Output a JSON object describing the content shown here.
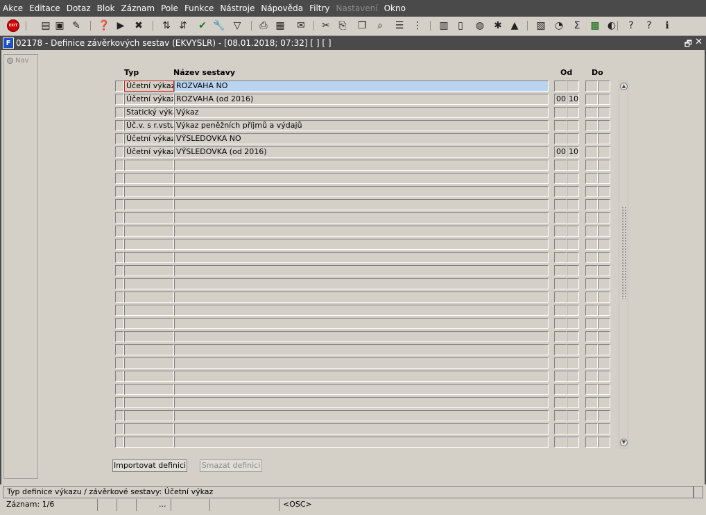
{
  "menu": [
    "Akce",
    "Editace",
    "Dotaz",
    "Blok",
    "Záznam",
    "Pole",
    "Funkce",
    "Nástroje",
    "Nápověda",
    "Filtry",
    "Nastavení",
    "Okno"
  ],
  "menu_disabled": [
    "Nastavení"
  ],
  "toolbar": {
    "exit_label": "EXIT",
    "icons": [
      "new-record-icon",
      "save-record-icon",
      "clear-icon",
      "query-icon",
      "execute-query-icon",
      "cancel-query-icon",
      "sort-asc-icon",
      "sort-desc-icon",
      "commit-check-icon",
      "tools-icon",
      "filter-icon",
      "print-icon",
      "print-setup-icon",
      "mail-icon",
      "cut-icon",
      "paste-icon",
      "copy-icon",
      "find-icon",
      "list-icon",
      "tree-icon",
      "calculator-icon",
      "document-icon",
      "globe-icon",
      "settings-icon",
      "triangle-icon",
      "chart-icon",
      "clock-icon",
      "sum-icon",
      "excel-icon",
      "web-icon",
      "help-icon",
      "context-help-icon",
      "info-icon"
    ]
  },
  "window": {
    "icon_text": "F",
    "title": "02178 - Definice závěrkových sestav (EKVYSLR) - [08.01.2018; 07:32]  [ ] [ ]",
    "restore": "🗗",
    "close": "✕"
  },
  "nav": {
    "label": "Nav"
  },
  "table": {
    "col_typ": "Typ",
    "col_nazev": "Název sestavy",
    "col_od": "Od",
    "col_do": "Do",
    "rows": [
      {
        "typ": "Účetní výkaz",
        "nazev": "ROZVAHA NO",
        "od1": "",
        "od2": "",
        "do1": "",
        "do2": ""
      },
      {
        "typ": "Účetní výkaz",
        "nazev": "ROZVAHA (od 2016)",
        "od1": "00",
        "od2": "10",
        "do1": "",
        "do2": ""
      },
      {
        "typ": "Statický výkaz",
        "nazev": "Výkaz",
        "od1": "",
        "od2": "",
        "do1": "",
        "do2": ""
      },
      {
        "typ": "Úč.v. s r.vstupy",
        "nazev": "Výkaz peněžních příjmů a výdajů",
        "od1": "",
        "od2": "",
        "do1": "",
        "do2": ""
      },
      {
        "typ": "Účetní výkaz",
        "nazev": "VÝSLEDOVKA NO",
        "od1": "",
        "od2": "",
        "do1": "",
        "do2": ""
      },
      {
        "typ": "Účetní výkaz",
        "nazev": "VÝSLEDOVKA (od 2016)",
        "od1": "00",
        "od2": "10",
        "do1": "",
        "do2": ""
      }
    ],
    "total_rows": 28
  },
  "buttons": {
    "import": "Importovat definici",
    "delete": "Smazat definici"
  },
  "status": {
    "hint": "Typ definice výkazu / závěrkové sestavy: Účetní výkaz",
    "record": "Záznam: 1/6",
    "dots": "...",
    "osc": "<OSC>"
  }
}
